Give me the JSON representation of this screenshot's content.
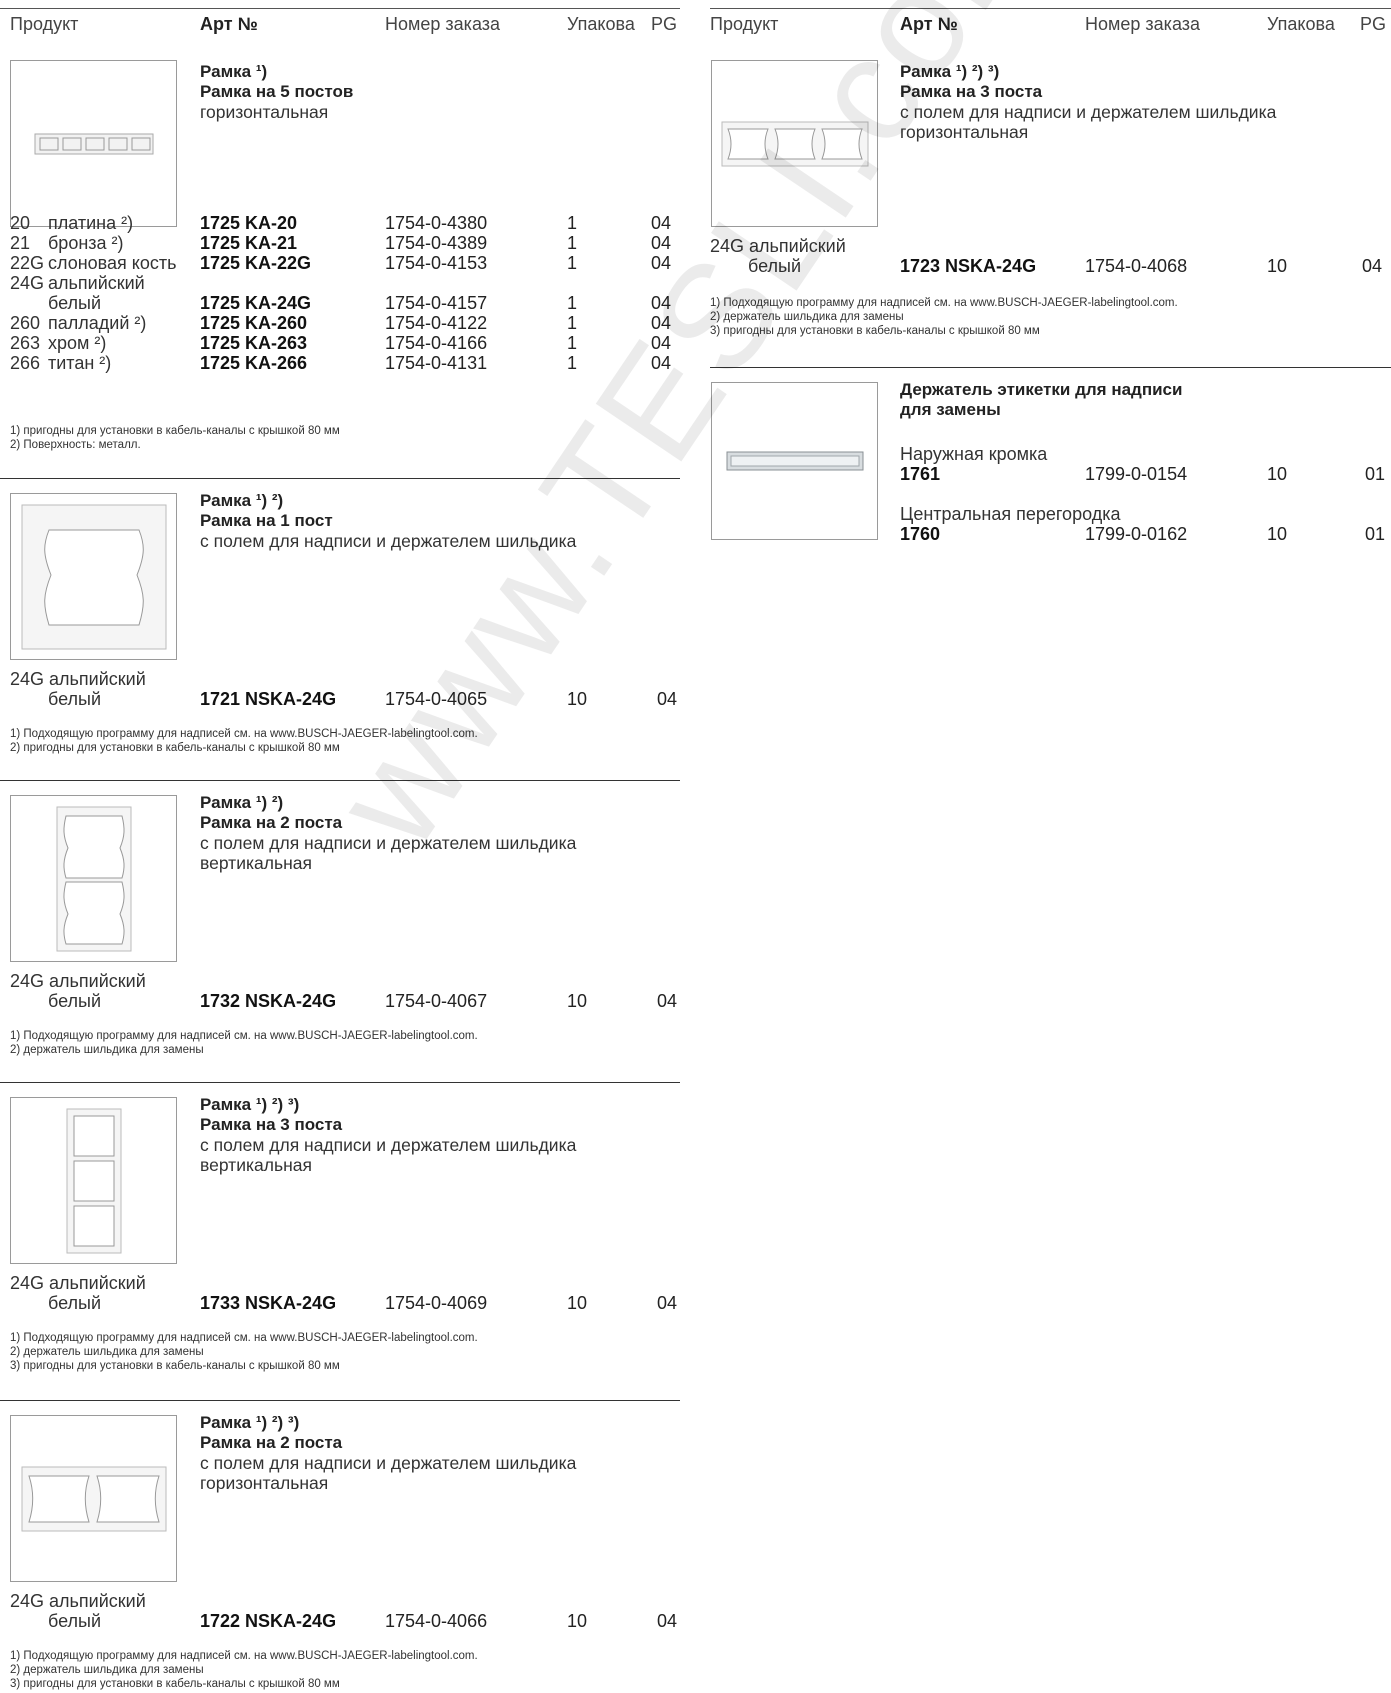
{
  "header": {
    "product": "Продукт",
    "art": "Арт №",
    "order": "Номер заказа",
    "pack": "Упакова",
    "pg": "PG"
  },
  "left": {
    "s1": {
      "title": "Рамка ¹)",
      "subtitle": "Рамка на 5 постов",
      "desc": "горизонтальная",
      "rows": [
        {
          "code": "20",
          "color": "платина ²)",
          "art": "1725 KA-20",
          "order": "1754-0-4380",
          "pack": "1",
          "pg": "04"
        },
        {
          "code": "21",
          "color": "бронза ²)",
          "art": "1725 KA-21",
          "order": "1754-0-4389",
          "pack": "1",
          "pg": "04"
        },
        {
          "code": "22G",
          "color": "слоновая кость",
          "art": "1725 KA-22G",
          "order": "1754-0-4153",
          "pack": "1",
          "pg": "04"
        },
        {
          "code": "24G",
          "color": "альпийский",
          "art": "",
          "order": "",
          "pack": "",
          "pg": ""
        },
        {
          "code": "",
          "color": "белый",
          "art": "1725 KA-24G",
          "order": "1754-0-4157",
          "pack": "1",
          "pg": "04"
        },
        {
          "code": "260",
          "color": "палладий ²)",
          "art": "1725 KA-260",
          "order": "1754-0-4122",
          "pack": "1",
          "pg": "04"
        },
        {
          "code": "263",
          "color": "хром ²)",
          "art": "1725 KA-263",
          "order": "1754-0-4166",
          "pack": "1",
          "pg": "04"
        },
        {
          "code": "266",
          "color": "титан ²)",
          "art": "1725 KA-266",
          "order": "1754-0-4131",
          "pack": "1",
          "pg": "04"
        }
      ],
      "notes": [
        "1)  пригодны для установки в кабель-каналы с крышкой 80 мм",
        "2)  Поверхность: металл."
      ]
    },
    "s2": {
      "title": "Рамка ¹) ²)",
      "subtitle": "Рамка на 1 пост",
      "desc": "с полем для надписи и держателем шильдика",
      "color1": "24G альпийский",
      "color2": "белый",
      "art": "1721 NSKA-24G",
      "order": "1754-0-4065",
      "pack": "10",
      "pg": "04",
      "notes": [
        "1)  Подходящую программу для надписей см. на www.BUSCH-JAEGER-labelingtool.com.",
        "2)  пригодны для установки в кабель-каналы с крышкой 80 мм"
      ]
    },
    "s3": {
      "title": "Рамка ¹) ²)",
      "subtitle": "Рамка на 2 поста",
      "desc": "с полем для надписи и держателем шильдика",
      "desc2": "вертикальная",
      "color1": "24G альпийский",
      "color2": "белый",
      "art": "1732 NSKA-24G",
      "order": "1754-0-4067",
      "pack": "10",
      "pg": "04",
      "notes": [
        "1)  Подходящую программу для надписей см. на www.BUSCH-JAEGER-labelingtool.com.",
        "2)  держатель шильдика для замены"
      ]
    },
    "s4": {
      "title": "Рамка ¹) ²) ³)",
      "subtitle": "Рамка на 3 поста",
      "desc": "с полем для надписи и держателем шильдика",
      "desc2": "вертикальная",
      "color1": "24G альпийский",
      "color2": "белый",
      "art": "1733 NSKA-24G",
      "order": "1754-0-4069",
      "pack": "10",
      "pg": "04",
      "notes": [
        "1)  Подходящую программу для надписей см. на www.BUSCH-JAEGER-labelingtool.com.",
        "2)  держатель шильдика для замены",
        "3)  пригодны для установки в кабель-каналы с крышкой 80 мм"
      ]
    },
    "s5": {
      "title": "Рамка ¹) ²) ³)",
      "subtitle": "Рамка на 2 поста",
      "desc": "с полем для надписи и держателем шильдика",
      "desc2": "горизонтальная",
      "color1": "24G альпийский",
      "color2": "белый",
      "art": "1722 NSKA-24G",
      "order": "1754-0-4066",
      "pack": "10",
      "pg": "04",
      "notes": [
        "1)  Подходящую программу для надписей см. на www.BUSCH-JAEGER-labelingtool.com.",
        "2)  держатель шильдика для замены",
        "3)  пригодны для установки в кабель-каналы с крышкой 80 мм"
      ]
    }
  },
  "right": {
    "s1": {
      "title": "Рамка ¹) ²) ³)",
      "subtitle": "Рамка на 3 поста",
      "desc": "с полем для надписи и держателем шильдика",
      "desc2": "горизонтальная",
      "color1": "24G альпийский",
      "color2": "белый",
      "art": "1723 NSKA-24G",
      "order": "1754-0-4068",
      "pack": "10",
      "pg": "04",
      "notes": [
        "1)  Подходящую программу для надписей см. на www.BUSCH-JAEGER-labelingtool.com.",
        "2)  держатель шильдика для замены",
        "3)  пригодны для установки в кабель-каналы с крышкой 80 мм"
      ]
    },
    "s2": {
      "title": "Держатель этикетки для надписи",
      "subtitle": "для замены",
      "item1_label": "Наружная кромка",
      "item1_art": "1761",
      "item1_order": "1799-0-0154",
      "item1_pack": "10",
      "item1_pg": "01",
      "item2_label": "Центральная перегородка",
      "item2_art": "1760",
      "item2_order": "1799-0-0162",
      "item2_pack": "10",
      "item2_pg": "01"
    }
  },
  "watermark": "www.TESLI.com"
}
